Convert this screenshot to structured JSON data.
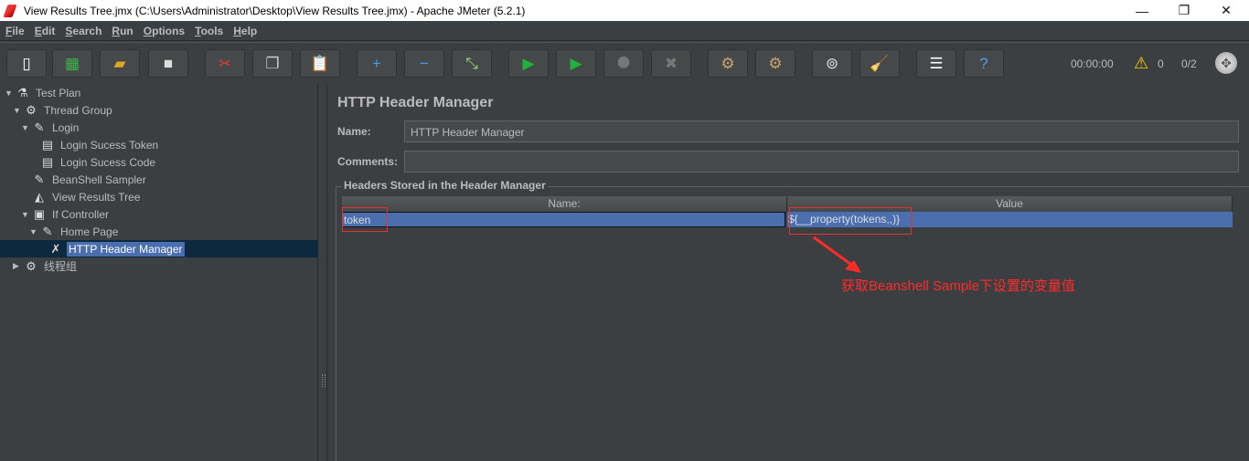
{
  "window": {
    "title": "View Results Tree.jmx (C:\\Users\\Administrator\\Desktop\\View Results Tree.jmx) - Apache JMeter (5.2.1)",
    "minimize": "—",
    "restore": "❐",
    "close": "✕"
  },
  "menu": [
    "File",
    "Edit",
    "Search",
    "Run",
    "Options",
    "Tools",
    "Help"
  ],
  "toolbar": {
    "buttons": [
      {
        "name": "new-button",
        "icon": "new-file-icon",
        "glyph": "▯",
        "color": "#ffffff"
      },
      {
        "name": "templates-button",
        "icon": "templates-icon",
        "glyph": "▦",
        "color": "#3bb34a"
      },
      {
        "name": "open-button",
        "icon": "folder-icon",
        "glyph": "▰",
        "color": "#e0a526"
      },
      {
        "name": "save-button",
        "icon": "floppy-icon",
        "glyph": "■",
        "color": "#dddddd"
      },
      {
        "name": "cut-button",
        "icon": "scissors-icon",
        "glyph": "✂",
        "color": "#e23b3b"
      },
      {
        "name": "copy-button",
        "icon": "copy-icon",
        "glyph": "❐",
        "color": "#cccccc"
      },
      {
        "name": "paste-button",
        "icon": "clipboard-icon",
        "glyph": "📋",
        "color": "#d7a047"
      },
      {
        "name": "expand-button",
        "icon": "plus-icon",
        "glyph": "+",
        "color": "#4a9be8"
      },
      {
        "name": "collapse-button",
        "icon": "minus-icon",
        "glyph": "−",
        "color": "#4a9be8"
      },
      {
        "name": "toggle-button",
        "icon": "toggle-icon",
        "glyph": "⤡",
        "color": "#9fd27b"
      },
      {
        "name": "start-button",
        "icon": "play-icon",
        "glyph": "▶",
        "color": "#1fb33a"
      },
      {
        "name": "start-no-pause-button",
        "icon": "play-no-timer-icon",
        "glyph": "▶",
        "color": "#1fb33a"
      },
      {
        "name": "stop-button",
        "icon": "stop-icon",
        "glyph": "⯃",
        "color": "#777777"
      },
      {
        "name": "shutdown-button",
        "icon": "shutdown-icon",
        "glyph": "✖",
        "color": "#777777"
      },
      {
        "name": "clear-button",
        "icon": "clear-gear-icon",
        "glyph": "⚙",
        "color": "#c8a070"
      },
      {
        "name": "clear-all-button",
        "icon": "clear-all-icon",
        "glyph": "⚙",
        "color": "#c8a070"
      },
      {
        "name": "search-button",
        "icon": "binoculars-icon",
        "glyph": "⊚",
        "color": "#dddddd"
      },
      {
        "name": "reset-search-button",
        "icon": "broom-icon",
        "glyph": "🧹",
        "color": "#f0c419"
      },
      {
        "name": "function-helper-button",
        "icon": "list-icon",
        "glyph": "☰",
        "color": "#ffffff"
      },
      {
        "name": "help-button",
        "icon": "help-book-icon",
        "glyph": "?",
        "color": "#5b9be8"
      }
    ],
    "timer": "00:00:00",
    "warnings": "0",
    "threads": "0/2"
  },
  "tree": [
    {
      "label": "Test Plan",
      "icon": "flask-icon",
      "glyph": "⚗",
      "depth": 0,
      "toggle": "▼"
    },
    {
      "label": "Thread Group",
      "icon": "gear-icon",
      "glyph": "⚙",
      "depth": 1,
      "toggle": "▼"
    },
    {
      "label": "Login",
      "icon": "pipette-icon",
      "glyph": "✎",
      "depth": 2,
      "toggle": "▼"
    },
    {
      "label": "Login Sucess Token",
      "icon": "assertion-doc-icon",
      "glyph": "▤",
      "depth": 3,
      "toggle": ""
    },
    {
      "label": "Login Sucess Code",
      "icon": "assertion-doc-icon",
      "glyph": "▤",
      "depth": 3,
      "toggle": ""
    },
    {
      "label": "BeanShell Sampler",
      "icon": "pipette-icon",
      "glyph": "✎",
      "depth": 2,
      "toggle": ""
    },
    {
      "label": "View Results Tree",
      "icon": "chart-icon",
      "glyph": "◭",
      "depth": 2,
      "toggle": ""
    },
    {
      "label": "If Controller",
      "icon": "controller-icon",
      "glyph": "▣",
      "depth": 2,
      "toggle": "▼"
    },
    {
      "label": "Home Page",
      "icon": "pipette-icon",
      "glyph": "✎",
      "depth": 3,
      "toggle": "▼"
    },
    {
      "label": "HTTP Header Manager",
      "icon": "wrench-icon",
      "glyph": "✗",
      "depth": 4,
      "toggle": "",
      "selected": true
    },
    {
      "label": "线程组",
      "icon": "gear-icon",
      "glyph": "⚙",
      "depth": 1,
      "toggle": "▶"
    }
  ],
  "main": {
    "title": "HTTP Header Manager",
    "name_label": "Name:",
    "name_value": "HTTP Header Manager",
    "comments_label": "Comments:",
    "comments_value": "",
    "group_title": "Headers Stored in the Header Manager",
    "columns": [
      "Name:",
      "Value"
    ],
    "rows": [
      [
        "token",
        "${__property(tokens,,)}"
      ]
    ]
  },
  "annotation": "获取Beanshell Sample下设置的变量值",
  "colors": {
    "background": "#3c3f41",
    "selection": "#4b6eaf",
    "annotation": "#ff2a2a"
  }
}
